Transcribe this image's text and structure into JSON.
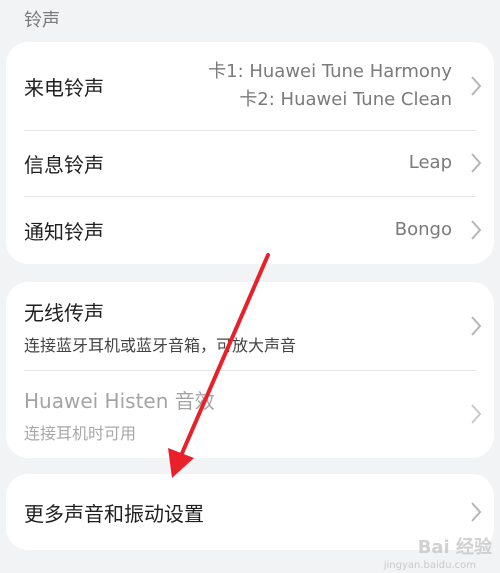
{
  "section": {
    "title": "铃声"
  },
  "card1": {
    "rows": [
      {
        "title": "来电铃声",
        "value_line1": "卡1: Huawei Tune Harmony",
        "value_line2": "卡2: Huawei Tune Clean"
      },
      {
        "title": "信息铃声",
        "value": "Leap"
      },
      {
        "title": "通知铃声",
        "value": "Bongo"
      }
    ]
  },
  "card2": {
    "rows": [
      {
        "title": "无线传声",
        "subtitle": "连接蓝牙耳机或蓝牙音箱，可放大声音"
      },
      {
        "title": "Huawei Histen 音效",
        "subtitle": "连接耳机时可用"
      }
    ]
  },
  "card3": {
    "rows": [
      {
        "title": "更多声音和振动设置"
      }
    ]
  },
  "watermark": {
    "text": "Bai 经验",
    "sub": "jingyan.baidu.com"
  },
  "colors": {
    "accent_arrow": "#e8202a",
    "background": "#f1f3f5"
  }
}
